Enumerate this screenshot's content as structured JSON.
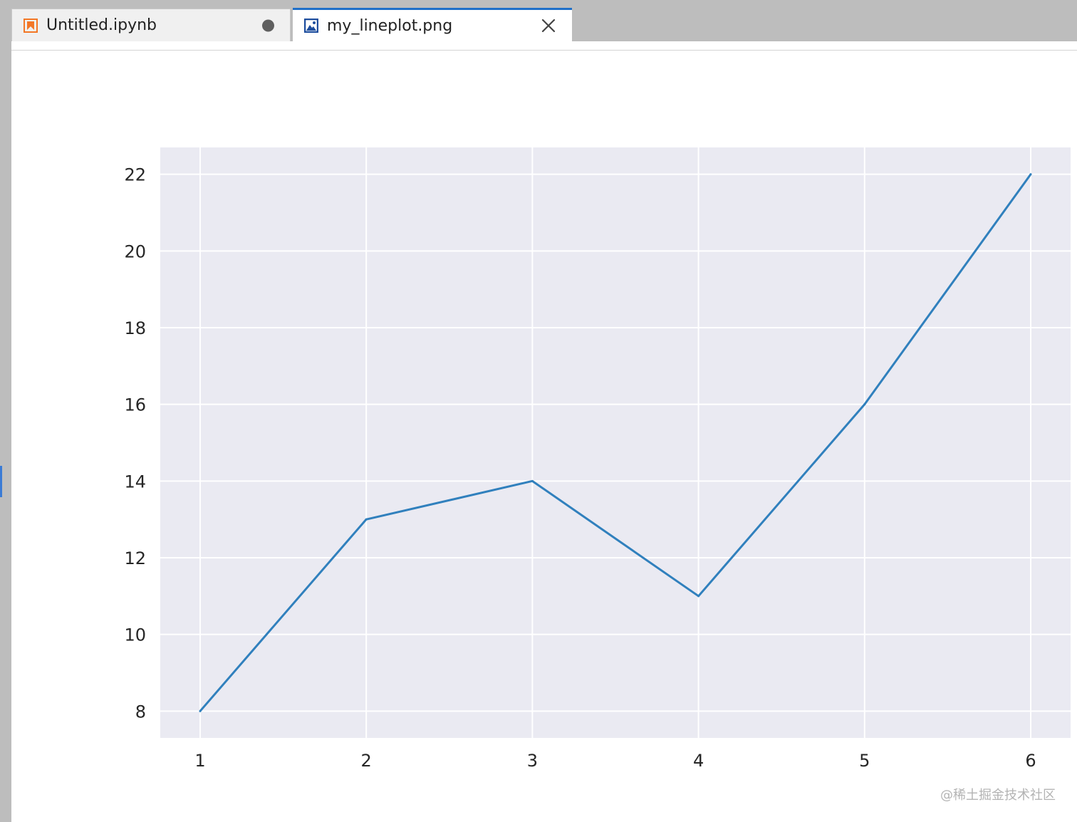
{
  "tabs": [
    {
      "label": "Untitled.ipynb",
      "icon": "notebook-icon",
      "icon_color": "#f37726",
      "state": "unsaved"
    },
    {
      "label": "my_lineplot.png",
      "icon": "image-icon",
      "icon_color": "#1e4e9e",
      "state": "active"
    }
  ],
  "colors": {
    "active_tab_accent": "#1f6fc8",
    "plot_background": "#eaeaf2",
    "grid": "#ffffff",
    "line": "#3080bd"
  },
  "watermark": "@稀土掘金技术社区",
  "chart_data": {
    "type": "line",
    "x": [
      1,
      2,
      3,
      4,
      5,
      6
    ],
    "series": [
      {
        "values": [
          8,
          13,
          14,
          11,
          16,
          22
        ]
      }
    ],
    "xticks": [
      1,
      2,
      3,
      4,
      5,
      6
    ],
    "yticks": [
      8,
      10,
      12,
      14,
      16,
      18,
      20,
      22
    ],
    "xlim": [
      0.76,
      6.24
    ],
    "ylim": [
      7.3,
      22.7
    ],
    "grid": true,
    "title": "",
    "xlabel": "",
    "ylabel": ""
  }
}
